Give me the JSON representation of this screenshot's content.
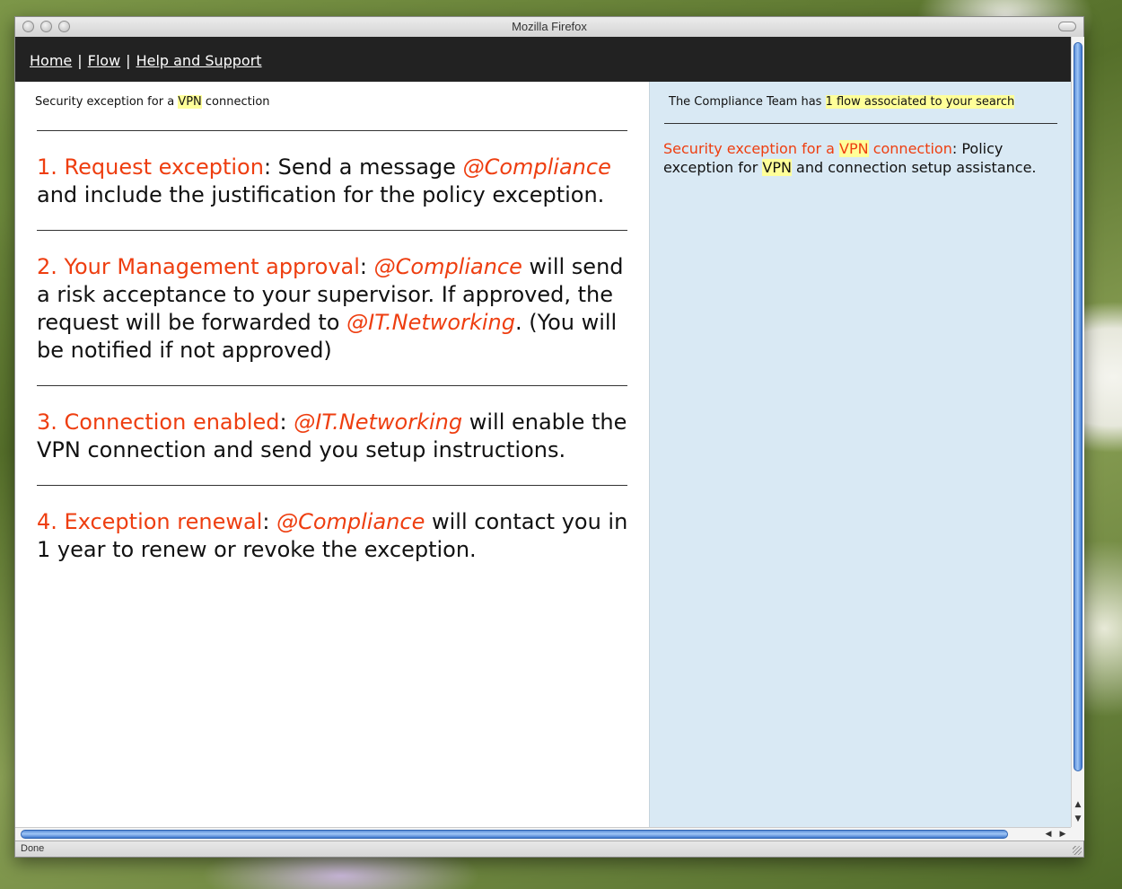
{
  "window": {
    "title": "Mozilla Firefox",
    "status": "Done"
  },
  "nav": {
    "home": "Home",
    "flow": "Flow",
    "help": "Help and Support",
    "separator": "|"
  },
  "left": {
    "breadcrumb": {
      "pre": "Security exception for a ",
      "keyword": "VPN",
      "post": " connection"
    },
    "steps": [
      {
        "title": "1. Request exception",
        "segments": [
          ": Send a message ",
          "@Compliance",
          " and include the justification for the policy exception."
        ]
      },
      {
        "title": "2. Your Management approval",
        "segments": [
          ": ",
          "@Compliance",
          " will send a risk acceptance to your supervisor. If approved, the request will be forwarded to ",
          "@IT.Networking",
          ". (You will be notified if not approved)"
        ]
      },
      {
        "title": "3. Connection enabled",
        "segments": [
          ": ",
          "@IT.Networking",
          " will enable the VPN connection and send you setup instructions."
        ]
      },
      {
        "title": "4. Exception renewal",
        "segments": [
          ": ",
          "@Compliance",
          " will contact you in 1 year to renew or revoke the exception."
        ]
      }
    ]
  },
  "right": {
    "summary_pre": "The Compliance Team has ",
    "summary_highlight": "1 flow associated to your search",
    "result": {
      "title_pre": "Security exception for a ",
      "title_keyword": "VPN",
      "title_post": " connection",
      "desc1": ": Policy exception for ",
      "desc_keyword": "VPN",
      "desc2": " and connection setup assistance."
    }
  },
  "icons": {
    "up": "▲",
    "down": "▼",
    "left": "◀",
    "right": "▶"
  }
}
